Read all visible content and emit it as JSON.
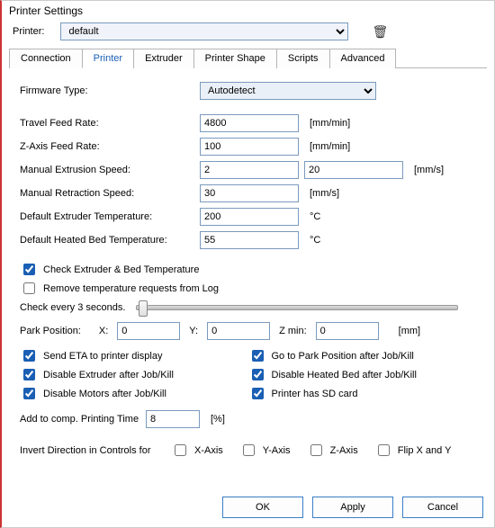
{
  "window": {
    "title": "Printer Settings"
  },
  "header": {
    "printer_label": "Printer:",
    "printer_value": "default",
    "trash_tooltip": "Delete printer"
  },
  "tabs": {
    "t0": "Connection",
    "t1": "Printer",
    "t2": "Extruder",
    "t3": "Printer Shape",
    "t4": "Scripts",
    "t5": "Advanced"
  },
  "labels": {
    "firmware_type": "Firmware Type:",
    "travel_feed": "Travel Feed Rate:",
    "z_feed": "Z-Axis Feed Rate:",
    "manual_ext": "Manual Extrusion Speed:",
    "manual_retr": "Manual Retraction Speed:",
    "def_ext_temp": "Default Extruder Temperature:",
    "def_bed_temp": "Default Heated Bed Temperature:",
    "check_temp": "Check Extruder & Bed Temperature",
    "remove_log": "Remove temperature requests from Log",
    "check_every": "Check every 3 seconds.",
    "park_pos": "Park Position:",
    "x": "X:",
    "y": "Y:",
    "zmin": "Z min:",
    "send_eta": "Send ETA to printer display",
    "disable_ext": "Disable Extruder after Job/Kill",
    "disable_mot": "Disable Motors after Job/Kill",
    "go_park": "Go to Park Position after Job/Kill",
    "disable_bed": "Disable Heated Bed after Job/Kill",
    "has_sd": "Printer has SD card",
    "add_time": "Add to comp. Printing Time",
    "invert": "Invert Direction in Controls for",
    "xaxis": "X-Axis",
    "yaxis": "Y-Axis",
    "zaxis": "Z-Axis",
    "flipxy": "Flip X and Y"
  },
  "values": {
    "firmware": "Autodetect",
    "travel_feed": "4800",
    "z_feed": "100",
    "manual_ext1": "2",
    "manual_ext2": "20",
    "manual_retr": "30",
    "ext_temp": "200",
    "bed_temp": "55",
    "park_x": "0",
    "park_y": "0",
    "park_z": "0",
    "add_time": "8"
  },
  "units": {
    "mm_min": "[mm/min]",
    "mm_s": "[mm/s]",
    "deg_c": "°C",
    "mm": "[mm]",
    "pct": "[%]"
  },
  "checks": {
    "check_temp": true,
    "remove_log": false,
    "send_eta": true,
    "disable_ext": true,
    "disable_mot": true,
    "go_park": true,
    "disable_bed": true,
    "has_sd": true,
    "xaxis": false,
    "yaxis": false,
    "zaxis": false,
    "flipxy": false
  },
  "buttons": {
    "ok": "OK",
    "apply": "Apply",
    "cancel": "Cancel"
  }
}
